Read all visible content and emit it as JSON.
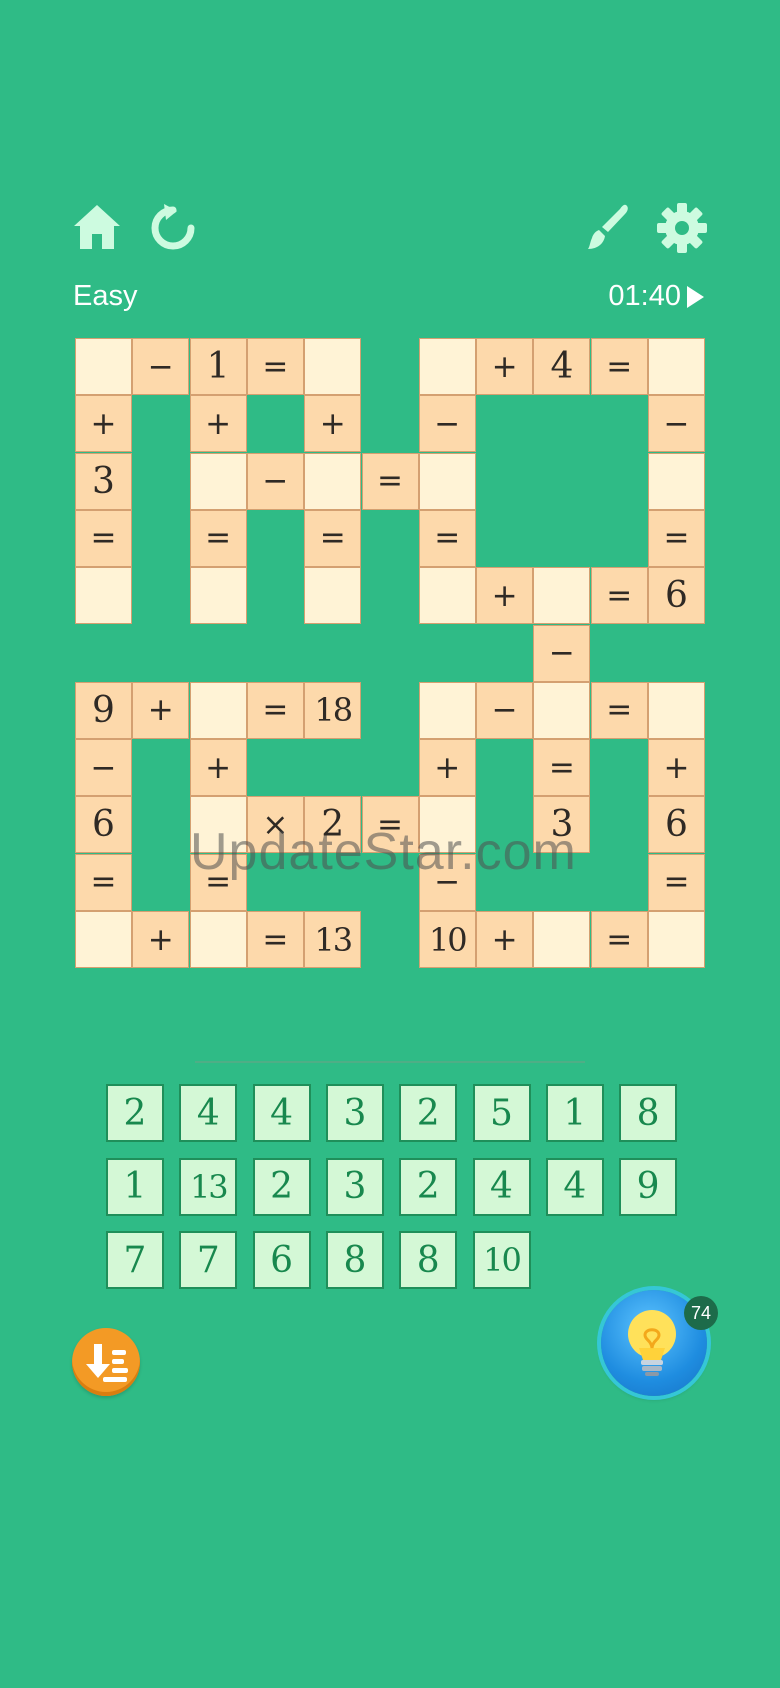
{
  "header": {
    "difficulty": "Easy",
    "timer": "01:40",
    "icons": [
      "home-icon",
      "restart-icon",
      "paint-brush-icon",
      "gear-icon",
      "play-icon"
    ]
  },
  "colors": {
    "background": "#2fbb86",
    "cell_empty": "#fff3d6",
    "cell_filled": "#fdd9ab",
    "tile_bg": "#d4f8d6",
    "tile_text": "#18884e",
    "hint_button": "#1f8de0",
    "sort_button": "#f39a25"
  },
  "grid": {
    "rows": 11,
    "cols": 11,
    "cells": [
      {
        "r": 0,
        "c": 0,
        "t": ""
      },
      {
        "r": 0,
        "c": 1,
        "t": "−"
      },
      {
        "r": 0,
        "c": 2,
        "t": "1"
      },
      {
        "r": 0,
        "c": 3,
        "t": "="
      },
      {
        "r": 0,
        "c": 4,
        "t": ""
      },
      {
        "r": 0,
        "c": 6,
        "t": ""
      },
      {
        "r": 0,
        "c": 7,
        "t": "+"
      },
      {
        "r": 0,
        "c": 8,
        "t": "4"
      },
      {
        "r": 0,
        "c": 9,
        "t": "="
      },
      {
        "r": 0,
        "c": 10,
        "t": ""
      },
      {
        "r": 1,
        "c": 0,
        "t": "+"
      },
      {
        "r": 1,
        "c": 2,
        "t": "+"
      },
      {
        "r": 1,
        "c": 4,
        "t": "+"
      },
      {
        "r": 1,
        "c": 6,
        "t": "−"
      },
      {
        "r": 1,
        "c": 10,
        "t": "−"
      },
      {
        "r": 2,
        "c": 0,
        "t": "3"
      },
      {
        "r": 2,
        "c": 2,
        "t": ""
      },
      {
        "r": 2,
        "c": 3,
        "t": "−"
      },
      {
        "r": 2,
        "c": 4,
        "t": ""
      },
      {
        "r": 2,
        "c": 5,
        "t": "="
      },
      {
        "r": 2,
        "c": 6,
        "t": ""
      },
      {
        "r": 2,
        "c": 10,
        "t": ""
      },
      {
        "r": 3,
        "c": 0,
        "t": "="
      },
      {
        "r": 3,
        "c": 2,
        "t": "="
      },
      {
        "r": 3,
        "c": 4,
        "t": "="
      },
      {
        "r": 3,
        "c": 6,
        "t": "="
      },
      {
        "r": 3,
        "c": 10,
        "t": "="
      },
      {
        "r": 4,
        "c": 0,
        "t": ""
      },
      {
        "r": 4,
        "c": 2,
        "t": ""
      },
      {
        "r": 4,
        "c": 4,
        "t": ""
      },
      {
        "r": 4,
        "c": 6,
        "t": ""
      },
      {
        "r": 4,
        "c": 7,
        "t": "+"
      },
      {
        "r": 4,
        "c": 8,
        "t": ""
      },
      {
        "r": 4,
        "c": 9,
        "t": "="
      },
      {
        "r": 4,
        "c": 10,
        "t": "6"
      },
      {
        "r": 5,
        "c": 8,
        "t": "−"
      },
      {
        "r": 6,
        "c": 0,
        "t": "9"
      },
      {
        "r": 6,
        "c": 1,
        "t": "+"
      },
      {
        "r": 6,
        "c": 2,
        "t": ""
      },
      {
        "r": 6,
        "c": 3,
        "t": "="
      },
      {
        "r": 6,
        "c": 4,
        "t": "18"
      },
      {
        "r": 6,
        "c": 6,
        "t": ""
      },
      {
        "r": 6,
        "c": 7,
        "t": "−"
      },
      {
        "r": 6,
        "c": 8,
        "t": ""
      },
      {
        "r": 6,
        "c": 9,
        "t": "="
      },
      {
        "r": 6,
        "c": 10,
        "t": ""
      },
      {
        "r": 7,
        "c": 0,
        "t": "−"
      },
      {
        "r": 7,
        "c": 2,
        "t": "+"
      },
      {
        "r": 7,
        "c": 6,
        "t": "+"
      },
      {
        "r": 7,
        "c": 8,
        "t": "="
      },
      {
        "r": 7,
        "c": 10,
        "t": "+"
      },
      {
        "r": 8,
        "c": 0,
        "t": "6"
      },
      {
        "r": 8,
        "c": 2,
        "t": ""
      },
      {
        "r": 8,
        "c": 3,
        "t": "×"
      },
      {
        "r": 8,
        "c": 4,
        "t": "2"
      },
      {
        "r": 8,
        "c": 5,
        "t": "="
      },
      {
        "r": 8,
        "c": 6,
        "t": ""
      },
      {
        "r": 8,
        "c": 8,
        "t": "3"
      },
      {
        "r": 8,
        "c": 10,
        "t": "6"
      },
      {
        "r": 9,
        "c": 0,
        "t": "="
      },
      {
        "r": 9,
        "c": 2,
        "t": "="
      },
      {
        "r": 9,
        "c": 6,
        "t": "−"
      },
      {
        "r": 9,
        "c": 10,
        "t": "="
      },
      {
        "r": 10,
        "c": 0,
        "t": ""
      },
      {
        "r": 10,
        "c": 1,
        "t": "+"
      },
      {
        "r": 10,
        "c": 2,
        "t": ""
      },
      {
        "r": 10,
        "c": 3,
        "t": "="
      },
      {
        "r": 10,
        "c": 4,
        "t": "13"
      },
      {
        "r": 10,
        "c": 6,
        "t": "10"
      },
      {
        "r": 10,
        "c": 7,
        "t": "+"
      },
      {
        "r": 10,
        "c": 8,
        "t": ""
      },
      {
        "r": 10,
        "c": 9,
        "t": "="
      },
      {
        "r": 10,
        "c": 10,
        "t": ""
      }
    ]
  },
  "watermark": "UpdateStar.com",
  "tiles": [
    [
      "2",
      "4",
      "4",
      "3",
      "2",
      "5",
      "1",
      "8"
    ],
    [
      "1",
      "13",
      "2",
      "3",
      "2",
      "4",
      "4",
      "9"
    ],
    [
      "7",
      "7",
      "6",
      "8",
      "8",
      "10"
    ]
  ],
  "controls": {
    "hint_count": "74",
    "icons": [
      "sort-icon",
      "lightbulb-icon"
    ]
  }
}
